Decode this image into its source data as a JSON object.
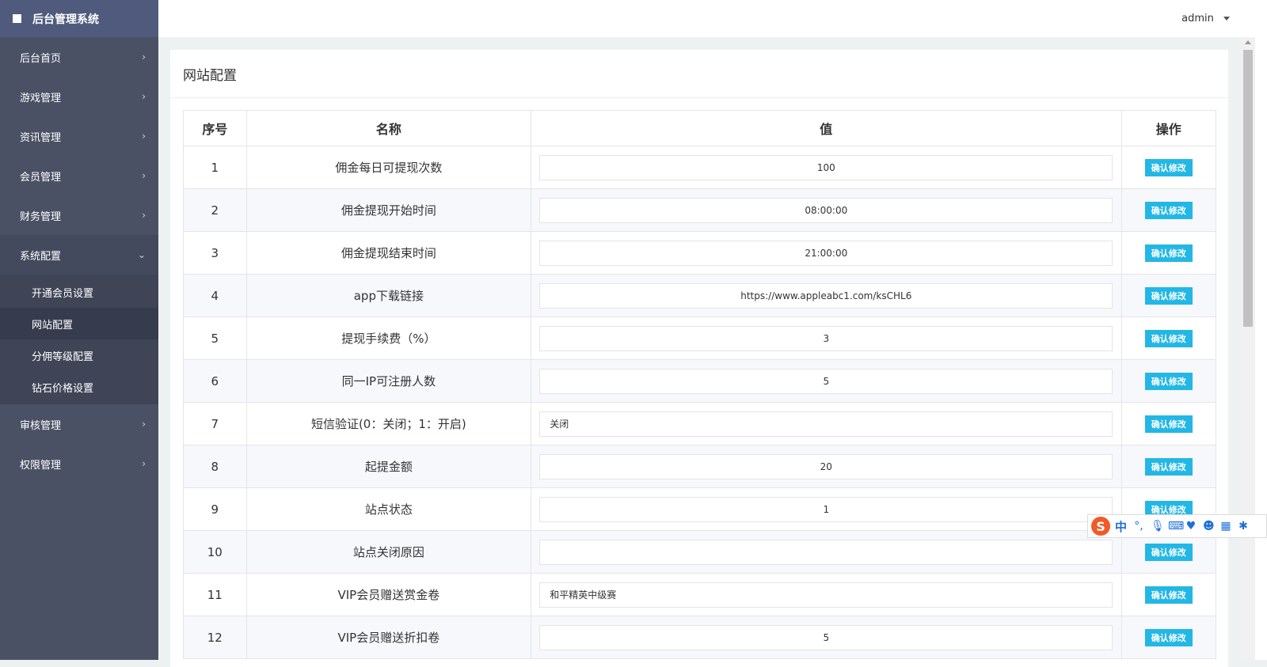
{
  "brand": {
    "title": "后台管理系统"
  },
  "header": {
    "user": "admin"
  },
  "sidebar": {
    "items_top": [
      {
        "label": "后台首页"
      },
      {
        "label": "游戏管理"
      },
      {
        "label": "资讯管理"
      },
      {
        "label": "会员管理"
      },
      {
        "label": "财务管理"
      }
    ],
    "open_item": {
      "label": "系统配置"
    },
    "sub_items": [
      {
        "label": "开通会员设置"
      },
      {
        "label": "网站配置"
      },
      {
        "label": "分佣等级配置"
      },
      {
        "label": "钻石价格设置"
      }
    ],
    "items_bottom": [
      {
        "label": "审核管理"
      },
      {
        "label": "权限管理"
      }
    ]
  },
  "panel": {
    "title": "网站配置"
  },
  "table": {
    "headers": {
      "no": "序号",
      "name": "名称",
      "value": "值",
      "action": "操作"
    },
    "button_label": "确认修改",
    "rows": [
      {
        "no": "1",
        "name": "佣金每日可提现次数",
        "value": "100"
      },
      {
        "no": "2",
        "name": "佣金提现开始时间",
        "value": "08:00:00"
      },
      {
        "no": "3",
        "name": "佣金提现结束时间",
        "value": "21:00:00"
      },
      {
        "no": "4",
        "name": "app下载链接",
        "value": "https://www.appleabc1.com/ksCHL6"
      },
      {
        "no": "5",
        "name": "提现手续费（%）",
        "value": "3"
      },
      {
        "no": "6",
        "name": "同一IP可注册人数",
        "value": "5"
      },
      {
        "no": "7",
        "name": "短信验证(0：关闭；1：开启)",
        "value": "关闭"
      },
      {
        "no": "8",
        "name": "起提金额",
        "value": "20"
      },
      {
        "no": "9",
        "name": "站点状态",
        "value": "1"
      },
      {
        "no": "10",
        "name": "站点关闭原因",
        "value": ""
      },
      {
        "no": "11",
        "name": "VIP会员赠送赏金卷",
        "value": "和平精英中级赛"
      },
      {
        "no": "12",
        "name": "VIP会员赠送折扣卷",
        "value": "5"
      }
    ]
  },
  "ime": {
    "logo": "S",
    "lang": "中"
  }
}
